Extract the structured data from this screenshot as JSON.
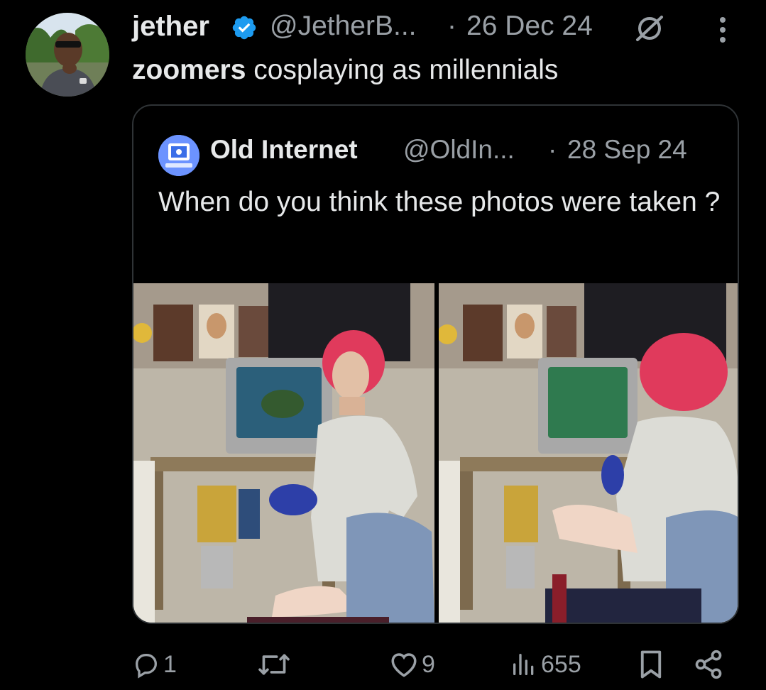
{
  "tweet": {
    "author_name": "jether",
    "author_handle": "@JetherB...",
    "separator": "·",
    "date": "26 Dec 24",
    "text_bold": "zoomers",
    "text_rest": " cosplaying as millennials"
  },
  "quote": {
    "author_name": "Old Internet",
    "author_handle": "@OldIn...",
    "separator": "·",
    "date": "28 Sep 24",
    "text": "When do you think these photos were taken ?"
  },
  "actions": {
    "replies": "1",
    "retweets": "",
    "likes": "9",
    "views": "655"
  },
  "icons": [
    "verified-badge-icon",
    "grok-icon",
    "more-icon",
    "reply-icon",
    "retweet-icon",
    "like-icon",
    "views-icon",
    "bookmark-icon",
    "share-icon"
  ],
  "colors": {
    "background": "#000000",
    "text": "#e7e9ea",
    "muted": "#9aa0a6",
    "verified": "#1d9bf0",
    "border": "#2f3336"
  }
}
